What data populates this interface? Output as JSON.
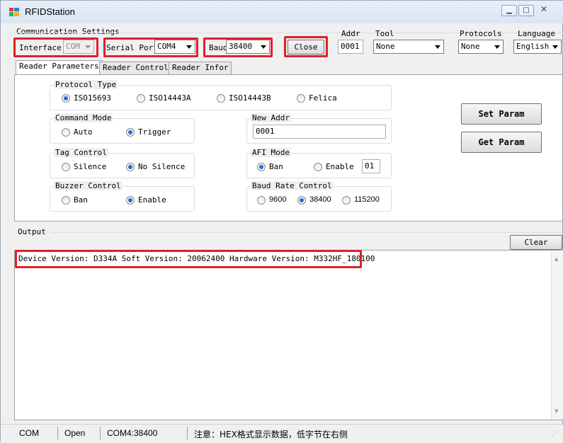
{
  "window": {
    "title": "RFIDStation"
  },
  "comm": {
    "group_label": "Communication Settings",
    "interface_label": "Interface",
    "interface_value": "COM",
    "serial_port_label": "Serial Port",
    "serial_port_value": "COM4",
    "baud_label": "Baud",
    "baud_value": "38400",
    "close_button": "Close",
    "addr_label": "Addr",
    "addr_value": "0001",
    "tool_label": "Tool",
    "tool_value": "None",
    "protocols_label": "Protocols",
    "protocols_value": "None",
    "language_label": "Language",
    "language_value": "English"
  },
  "tabs": [
    {
      "label": "Reader Parameters"
    },
    {
      "label": "Reader Control"
    },
    {
      "label": "Reader Infor"
    }
  ],
  "params": {
    "protocol_type": {
      "title": "Protocol Type",
      "options": [
        "ISO15693",
        "ISO14443A",
        "ISO14443B",
        "Felica"
      ],
      "selected": 0
    },
    "command_mode": {
      "title": "Command Mode",
      "options": [
        "Auto",
        "Trigger"
      ],
      "selected": 1
    },
    "tag_control": {
      "title": "Tag Control",
      "options": [
        "Silence",
        "No Silence"
      ],
      "selected": 1
    },
    "buzzer_control": {
      "title": "Buzzer Control",
      "options": [
        "Ban",
        "Enable"
      ],
      "selected": 1
    },
    "new_addr": {
      "title": "New Addr",
      "value": "0001"
    },
    "afi_mode": {
      "title": "AFI Mode",
      "options": [
        "Ban",
        "Enable"
      ],
      "selected": 0,
      "value": "01"
    },
    "baud_rate_control": {
      "title": "Baud Rate Control",
      "options": [
        "9600",
        "38400",
        "115200"
      ],
      "selected": 1
    },
    "set_param_button": "Set Param",
    "get_param_button": "Get Param"
  },
  "output": {
    "label": "Output",
    "clear_button": "Clear",
    "lines": [
      "Device Version: D334A Soft Version: 20062400  Hardware Version: M332HF_180100"
    ]
  },
  "status": {
    "port_type": "COM",
    "state": "Open",
    "port_baud": "COM4:38400",
    "note": "注意：HEX格式显示数据，低字节在右侧"
  },
  "colors": {
    "highlight": "#e0202a",
    "radio_selected": "#1e6fd9"
  }
}
